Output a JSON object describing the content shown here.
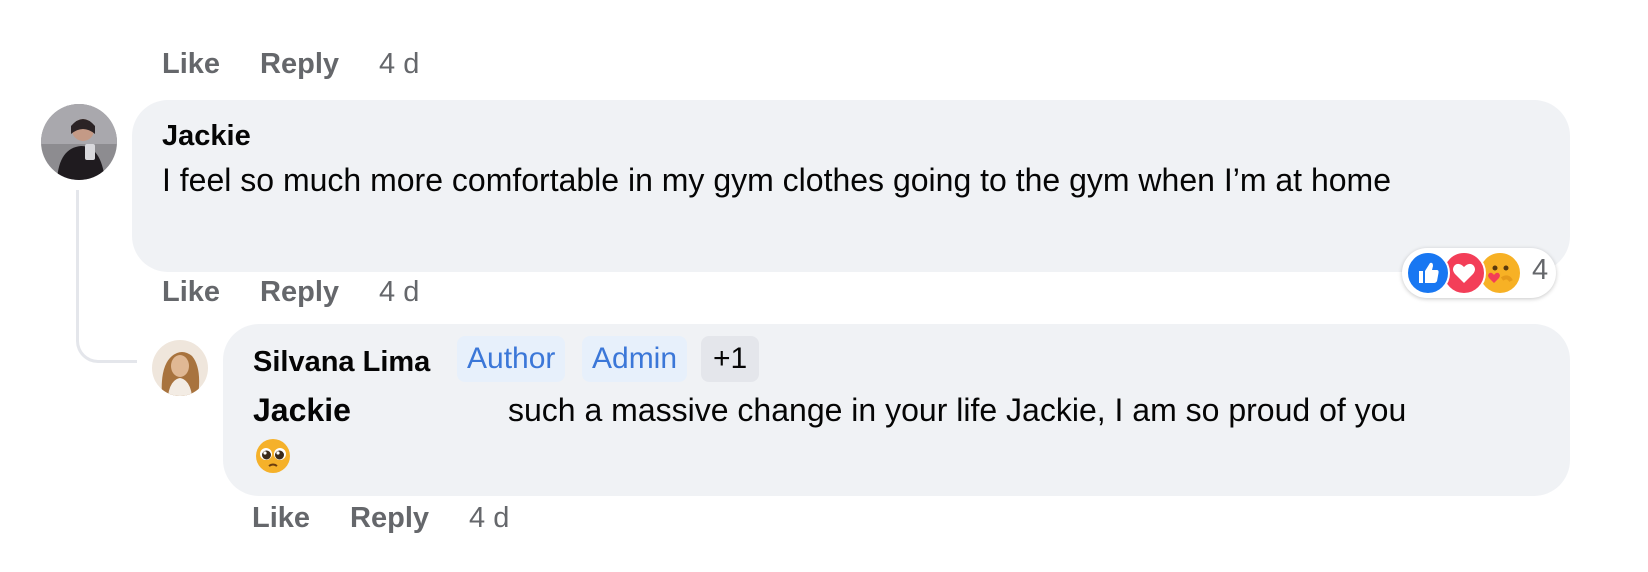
{
  "top_actions": {
    "like": "Like",
    "reply": "Reply",
    "time": "4 d"
  },
  "comment": {
    "author": "Jackie",
    "text": "I feel so much more comfortable in my gym clothes going to the gym when I’m at home",
    "actions": {
      "like": "Like",
      "reply": "Reply",
      "time": "4 d"
    },
    "reactions": {
      "icons": [
        "like-icon",
        "love-icon",
        "care-icon"
      ],
      "count": "4"
    }
  },
  "reply": {
    "author": "Silvana Lima",
    "badges": {
      "author": "Author",
      "admin": "Admin",
      "more": "+1"
    },
    "mention": "Jackie",
    "text": "such a massive change in your life Jackie, I am so proud of you",
    "emoji": "pleading-face-emoji",
    "actions": {
      "like": "Like",
      "reply": "Reply",
      "time": "4 d"
    }
  },
  "colors": {
    "bubble": "#f0f2f5",
    "meta_text": "#65676b",
    "badge_bg": "#e7f0fb",
    "badge_text": "#3b77d8",
    "like_blue": "#1877f2",
    "love_red": "#f33e58",
    "care_yellow": "#f7b125"
  }
}
